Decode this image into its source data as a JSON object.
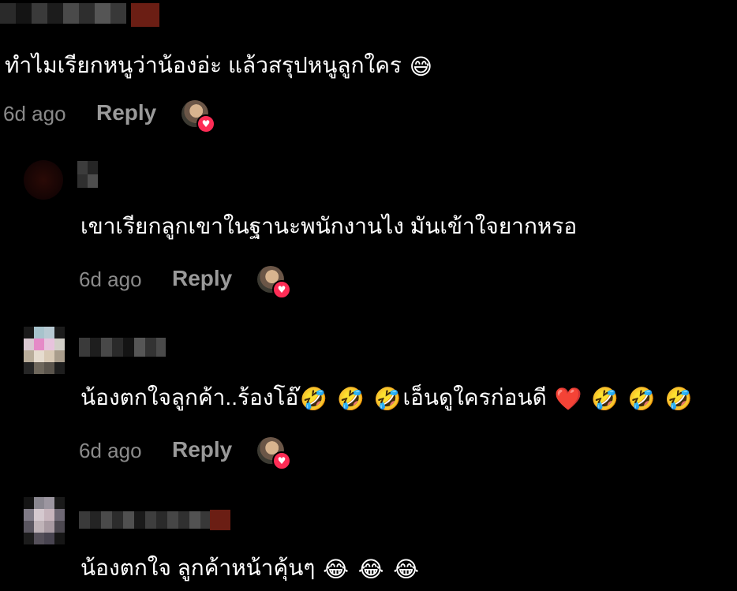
{
  "comments": [
    {
      "text": "ทำไมเรียกหนูว่าน้องอ่ะ แล้วสรุปหนูลูกใคร",
      "time": "6d ago",
      "reply": "Reply"
    },
    {
      "text": "เขาเรียกลูกเขาในฐานะพนักงานไง มันเข้าใจยากหรอ",
      "time": "6d ago",
      "reply": "Reply"
    },
    {
      "text_a": "น้องตกใจลูกค้า..ร้องโอ๊",
      "text_b": "เอ็นดูใครก่อนดี",
      "time": "6d ago",
      "reply": "Reply"
    },
    {
      "text": "น้องตกใจ ลูกค้าหน้าคุ้นๆ"
    }
  ],
  "icons": {
    "sweat_smile": "😅",
    "rofl": "🤣",
    "heart": "❤️",
    "joy": "😂",
    "creator_heart": "♥"
  },
  "colors": {
    "background": "#000000",
    "meta_gray": "#8a8a8a",
    "reply_gray": "#9a9a9a",
    "like_pink": "#fe2c55"
  }
}
